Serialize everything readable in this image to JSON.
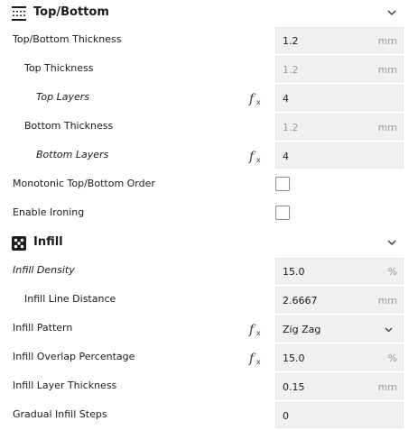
{
  "top_bottom": {
    "title": "Top/Bottom",
    "icon": "top-bottom-icon",
    "rows": {
      "thickness": {
        "label": "Top/Bottom Thickness",
        "value": "1.2",
        "unit": "mm"
      },
      "top_thickness": {
        "label": "Top Thickness",
        "value": "1.2",
        "unit": "mm"
      },
      "top_layers": {
        "label": "Top Layers",
        "value": "4"
      },
      "bottom_thickness": {
        "label": "Bottom Thickness",
        "value": "1.2",
        "unit": "mm"
      },
      "bottom_layers": {
        "label": "Bottom Layers",
        "value": "4"
      },
      "monotonic": {
        "label": "Monotonic Top/Bottom Order",
        "checked": false
      },
      "ironing": {
        "label": "Enable Ironing",
        "checked": false
      }
    }
  },
  "infill": {
    "title": "Infill",
    "icon": "infill-icon",
    "rows": {
      "density": {
        "label": "Infill Density",
        "value": "15.0",
        "unit": "%"
      },
      "line_distance": {
        "label": "Infill Line Distance",
        "value": "2.6667",
        "unit": "mm"
      },
      "pattern": {
        "label": "Infill Pattern",
        "value": "Zig Zag"
      },
      "overlap": {
        "label": "Infill Overlap Percentage",
        "value": "15.0",
        "unit": "%"
      },
      "layer_thickness": {
        "label": "Infill Layer Thickness",
        "value": "0.15",
        "unit": "mm"
      },
      "gradual_steps": {
        "label": "Gradual Infill Steps",
        "value": "0"
      }
    }
  },
  "colors": {
    "field_bg": "#f0f0f0",
    "muted_text": "#9a9a9a",
    "text": "#1b1b1b"
  }
}
